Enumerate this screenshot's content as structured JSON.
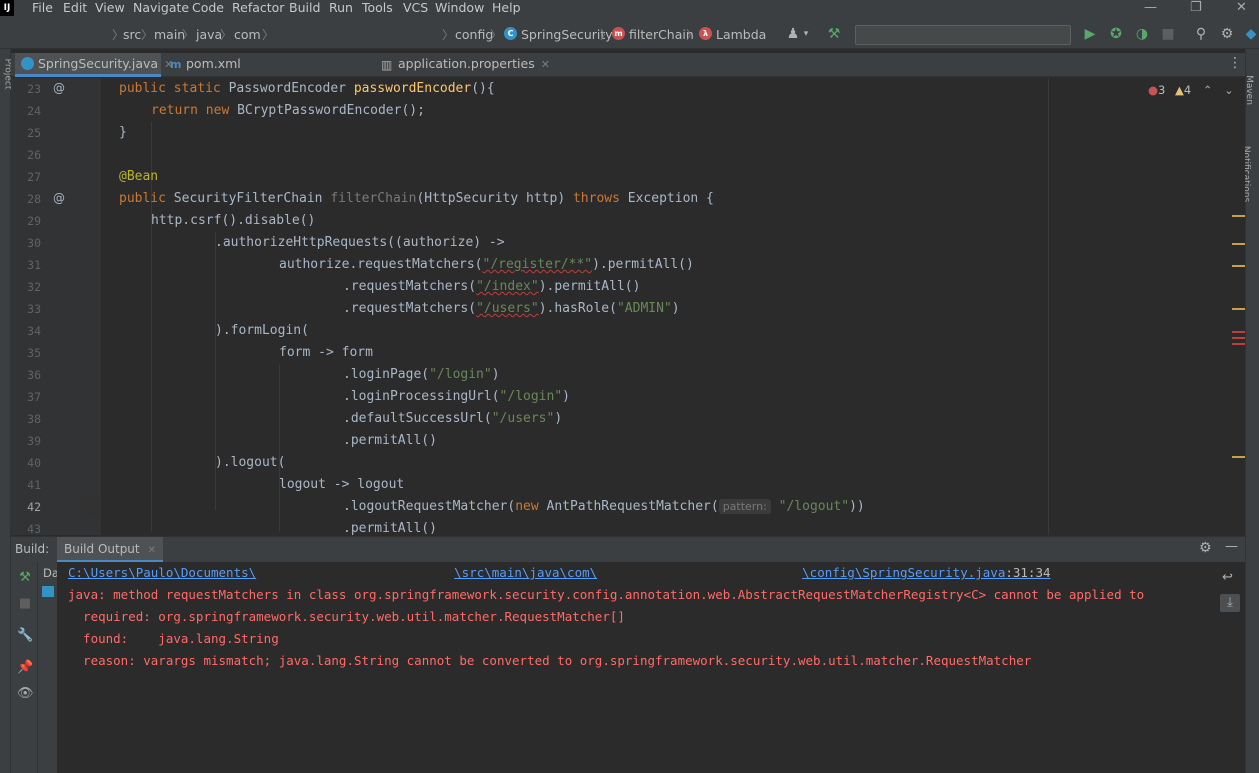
{
  "menu": {
    "logo": "IJ",
    "items": [
      "File",
      "Edit",
      "View",
      "Navigate",
      "Code",
      "Refactor",
      "Build",
      "Run",
      "Tools",
      "VCS",
      "Window",
      "Help"
    ]
  },
  "window_controls": {
    "minimize": "—",
    "restore": "❐",
    "close": "✕"
  },
  "breadcrumb": {
    "left": [
      "src",
      "main",
      "java",
      "com"
    ],
    "right": [
      "config",
      "SpringSecurity",
      "filterChain",
      "Lambda"
    ]
  },
  "tabs": [
    {
      "label": "SpringSecurity.java",
      "active": true,
      "icon_color": "#3592c4"
    },
    {
      "label": "pom.xml",
      "active": false
    },
    {
      "label": "application.properties",
      "active": false
    }
  ],
  "inspections": {
    "errors": "3",
    "warnings": "4"
  },
  "left_tool_label": "Project",
  "right_tool_labels": [
    "Maven",
    "Notifications"
  ],
  "code_lines": [
    {
      "n": "23",
      "mark": "@"
    },
    {
      "n": "24"
    },
    {
      "n": "25"
    },
    {
      "n": "26"
    },
    {
      "n": "27"
    },
    {
      "n": "28",
      "mark": "@"
    },
    {
      "n": "29"
    },
    {
      "n": "30"
    },
    {
      "n": "31"
    },
    {
      "n": "32"
    },
    {
      "n": "33"
    },
    {
      "n": "34"
    },
    {
      "n": "35"
    },
    {
      "n": "36"
    },
    {
      "n": "37"
    },
    {
      "n": "38"
    },
    {
      "n": "39"
    },
    {
      "n": "40"
    },
    {
      "n": "41"
    },
    {
      "n": "42",
      "current": true
    },
    {
      "n": "43"
    }
  ],
  "code": {
    "l23": {
      "kw1": "public static ",
      "type": "PasswordEncoder ",
      "fn": "passwordEncoder",
      "rest": "(){"
    },
    "l24": {
      "kw": "return new ",
      "rest": "BCryptPasswordEncoder();"
    },
    "l25": "}",
    "l27": "@Bean",
    "l28": {
      "kw1": "public ",
      "type": "SecurityFilterChain ",
      "fn": "filterChain",
      "rest1": "(HttpSecurity http) ",
      "kw2": "throws ",
      "rest2": "Exception {"
    },
    "l29": "http.csrf().disable()",
    "l30": ".authorizeHttpRequests((authorize) ->",
    "l31": {
      "a": "authorize.requestMatchers(",
      "s": "\"/register/**\"",
      "b": ").permitAll()"
    },
    "l32": {
      "a": ".requestMatchers(",
      "s": "\"/index\"",
      "b": ").permitAll()"
    },
    "l33": {
      "a": ".requestMatchers(",
      "s": "\"/users\"",
      "b": ").hasRole(",
      "s2": "\"ADMIN\"",
      "c": ")"
    },
    "l34": ").formLogin(",
    "l35": "form -> form",
    "l36": {
      "a": ".loginPage(",
      "s": "\"/login\"",
      "b": ")"
    },
    "l37": {
      "a": ".loginProcessingUrl(",
      "s": "\"/login\"",
      "b": ")"
    },
    "l38": {
      "a": ".defaultSuccessUrl(",
      "s": "\"/users\"",
      "b": ")"
    },
    "l39": ".permitAll()",
    "l40": ").logout(",
    "l41": "logout -> logout",
    "l42": {
      "a": ".logoutRequestMatcher(",
      "kw": "new ",
      "b": "AntPathRequestMatcher(",
      "hint": "pattern:",
      "s": "\"/logout\"",
      "c": "))"
    },
    "l43": ".permitAll()"
  },
  "build_panel": {
    "label": "Build:",
    "tab": "Build Output",
    "tree_label": "Da",
    "output": {
      "path_a": "C:\\Users\\Paulo\\Documents\\",
      "path_b": "\\src\\main\\java\\com\\",
      "path_c": "\\config\\SpringSecurity.java",
      "path_pos": ":31:34",
      "line1": "java: method requestMatchers in class org.springframework.security.config.annotation.web.AbstractRequestMatcherRegistry<C> cannot be applied to",
      "line2": "  required: org.springframework.security.web.util.matcher.RequestMatcher[]",
      "line3": "  found:    java.lang.String",
      "line4": "  reason: varargs mismatch; java.lang.String cannot be converted to org.springframework.security.web.util.matcher.RequestMatcher"
    }
  },
  "colors": {
    "accent": "#4a88c7",
    "error": "#ff6b68",
    "link": "#589df6",
    "run_green": "#59a869",
    "warning": "#e5c07b"
  }
}
